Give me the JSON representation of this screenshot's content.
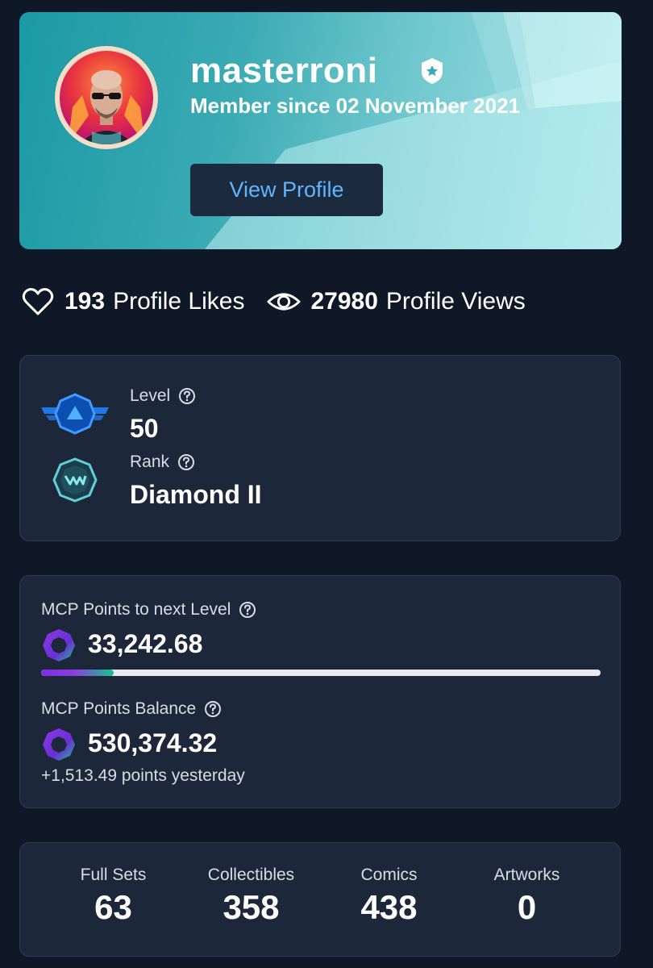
{
  "profile": {
    "username": "masterroni",
    "member_since": "Member since 02 November 2021",
    "view_profile_label": "View Profile"
  },
  "stats": {
    "likes_value": "193",
    "likes_label": "Profile Likes",
    "views_value": "27980",
    "views_label": "Profile Views"
  },
  "level_card": {
    "level_label": "Level",
    "level_value": "50",
    "rank_label": "Rank",
    "rank_value": "Diamond II"
  },
  "mcp_card": {
    "next_label": "MCP Points to next Level",
    "next_value": "33,242.68",
    "progress_fraction": 0.13,
    "balance_label": "MCP Points Balance",
    "balance_value": "530,374.32",
    "yesterday_text": "+1,513.49 points yesterday"
  },
  "totals": [
    {
      "label": "Full Sets",
      "value": "63"
    },
    {
      "label": "Collectibles",
      "value": "358"
    },
    {
      "label": "Comics",
      "value": "438"
    },
    {
      "label": "Artworks",
      "value": "0"
    }
  ],
  "icons": {
    "heart": "heart-icon",
    "eye": "eye-icon",
    "help": "help-circle-icon",
    "level": "level-badge-icon",
    "rank": "rank-badge-icon",
    "points": "mcp-points-icon",
    "verified": "verified-badge-icon"
  },
  "colors": {
    "background": "#0e1826",
    "card": "#1c2839",
    "accent_blue": "#5fb5ff",
    "header_teal": "#3aaab3"
  }
}
